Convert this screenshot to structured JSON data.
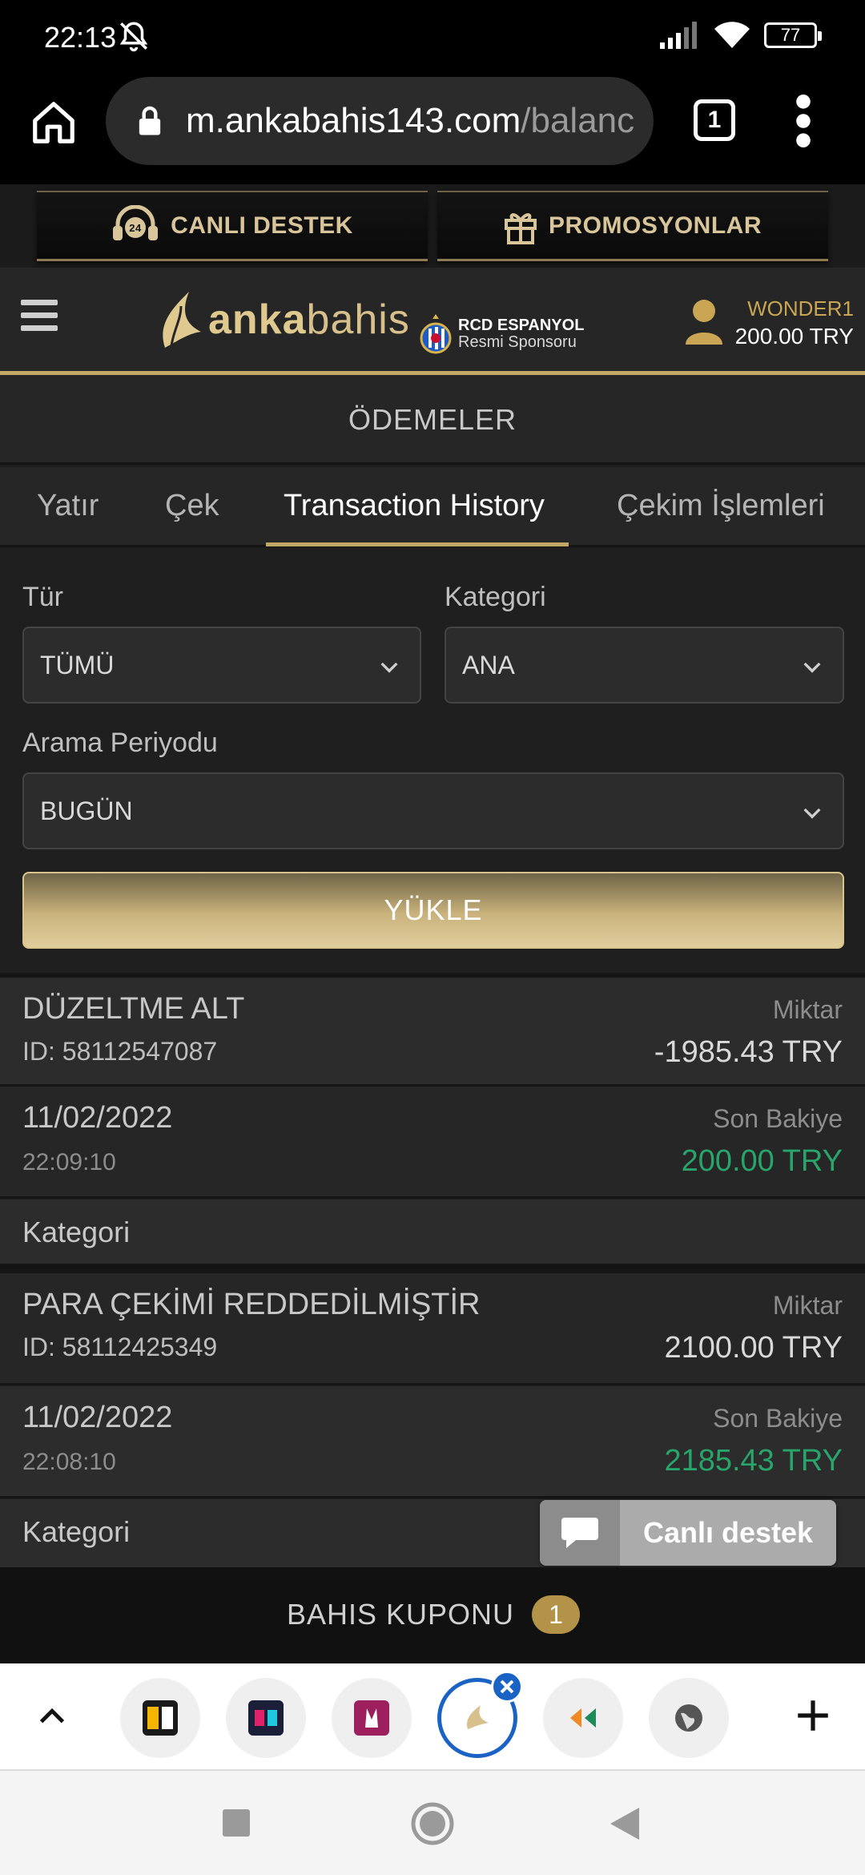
{
  "status_bar": {
    "time": "22:13",
    "battery": "77"
  },
  "browser": {
    "url_main": "m.ankabahis143.com",
    "url_rest": "/balanc",
    "tab_count": "1"
  },
  "promo": {
    "support_label": "CANLI DESTEK",
    "promotions_label": "PROMOSYONLAR",
    "support_badge": "24"
  },
  "header": {
    "logo_bold": "anka",
    "logo_light": "bahis",
    "sponsor_title": "RCD ESPANYOL",
    "sponsor_sub": "Resmi Sponsoru",
    "username": "WONDER1",
    "balance": "200.00 TRY"
  },
  "page": {
    "title": "ÖDEMELER"
  },
  "tabs": [
    {
      "label": "Yatır"
    },
    {
      "label": "Çek"
    },
    {
      "label": "Transaction History"
    },
    {
      "label": "Çekim İşlemleri"
    }
  ],
  "filters": {
    "type_label": "Tür",
    "type_value": "TÜMÜ",
    "category_label": "Kategori",
    "category_value": "ANA",
    "period_label": "Arama Periyodu",
    "period_value": "BUGÜN",
    "load_button": "YÜKLE"
  },
  "transactions": [
    {
      "title": "DÜZELTME ALT",
      "id": "ID: 58112547087",
      "amount_label": "Miktar",
      "amount": "-1985.43 TRY",
      "date": "11/02/2022",
      "time": "22:09:10",
      "balance_label": "Son Bakiye",
      "balance": "200.00 TRY",
      "category_label": "Kategori"
    },
    {
      "title": "PARA ÇEKİMİ REDDEDİLMİŞTİR",
      "id": "ID: 58112425349",
      "amount_label": "Miktar",
      "amount": "2100.00 TRY",
      "date": "11/02/2022",
      "time": "22:08:10",
      "balance_label": "Son Bakiye",
      "balance": "2185.43 TRY",
      "category_label": "Kategori"
    }
  ],
  "chat": {
    "label": "Canlı destek"
  },
  "betslip": {
    "label": "BAHIS KUPONU",
    "count": "1"
  },
  "colors": {
    "gold": "#c2a766",
    "green": "#27a56b",
    "background": "#1e1e1e"
  }
}
